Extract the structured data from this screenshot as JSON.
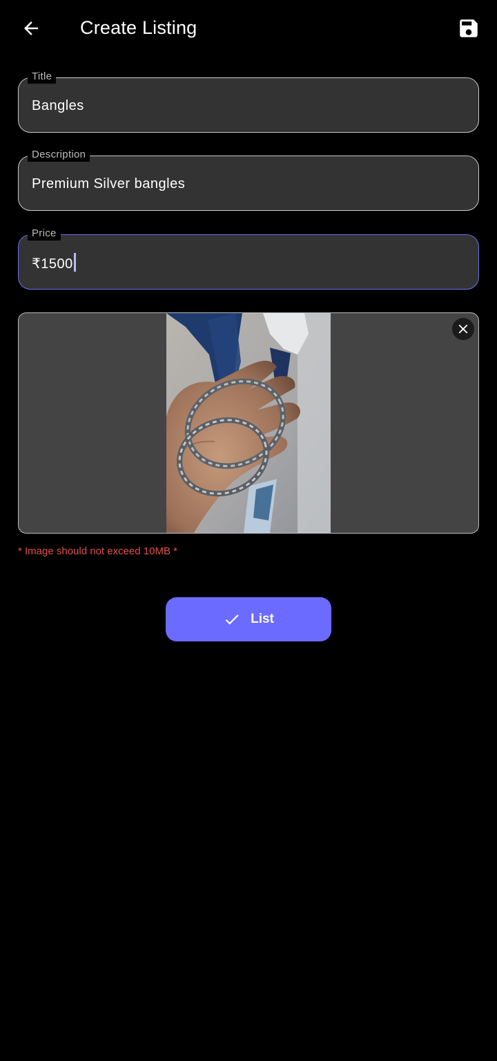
{
  "header": {
    "title": "Create Listing",
    "back_icon": "arrow-left-icon",
    "save_icon": "floppy-disk-icon"
  },
  "form": {
    "title": {
      "label": "Title",
      "value": "Bangles"
    },
    "description": {
      "label": "Description",
      "value": "Premium Silver bangles"
    },
    "price": {
      "label": "Price",
      "value": "₹1500"
    }
  },
  "image_upload": {
    "remove_icon": "close-icon",
    "note": "* Image should not exceed 10MB *"
  },
  "actions": {
    "list_label": "List",
    "list_icon": "check-icon"
  },
  "colors": {
    "background": "#000000",
    "field_fill": "#333333",
    "accent": "#6b6bff",
    "error": "#e0504d"
  }
}
